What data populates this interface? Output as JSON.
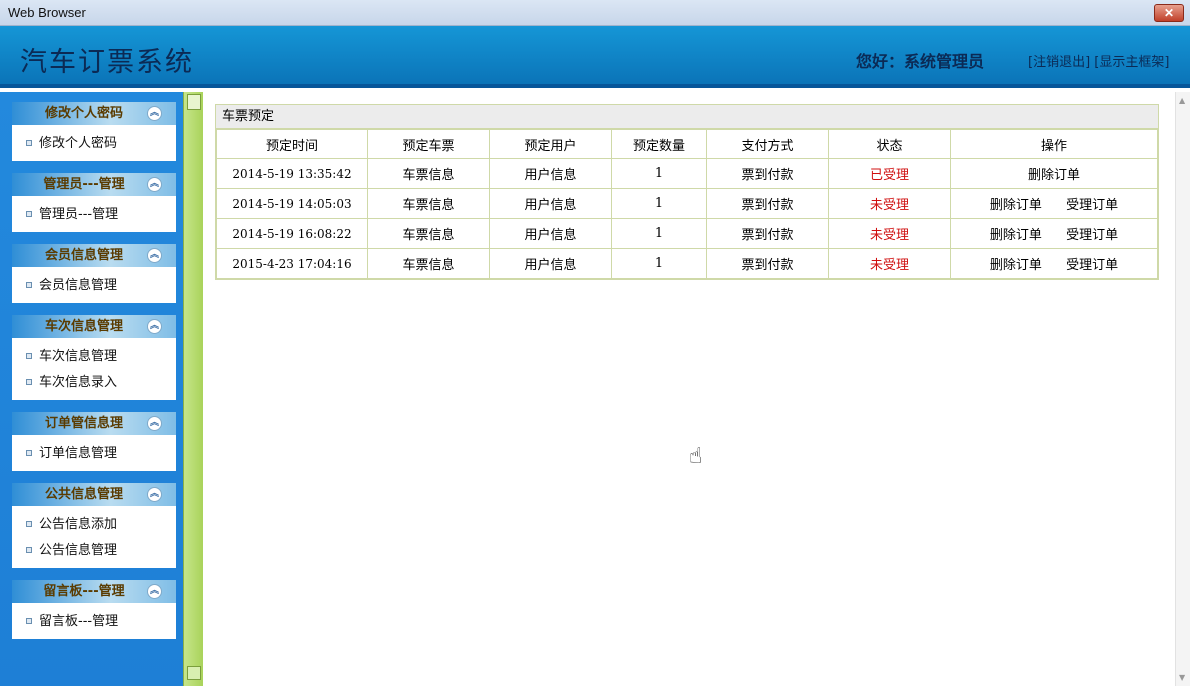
{
  "window": {
    "title": "Web Browser",
    "close_glyph": "✕"
  },
  "header": {
    "app_title": "汽车订票系统",
    "greeting": "您好：系统管理员",
    "logout_label": "[注销退出]",
    "toggle_label": "[显示主框架]"
  },
  "sidebar": {
    "groups": [
      {
        "title": "修改个人密码",
        "items": [
          "修改个人密码"
        ]
      },
      {
        "title": "管理员---管理",
        "items": [
          "管理员---管理"
        ]
      },
      {
        "title": "会员信息管理",
        "items": [
          "会员信息管理"
        ]
      },
      {
        "title": "车次信息管理",
        "items": [
          "车次信息管理",
          "车次信息录入"
        ]
      },
      {
        "title": "订单管信息理",
        "items": [
          "订单信息管理"
        ]
      },
      {
        "title": "公共信息管理",
        "items": [
          "公告信息添加",
          "公告信息管理"
        ]
      },
      {
        "title": "留言板---管理",
        "items": [
          "留言板---管理"
        ]
      }
    ]
  },
  "panel": {
    "title": "车票预定",
    "columns": [
      "预定时间",
      "预定车票",
      "预定用户",
      "预定数量",
      "支付方式",
      "状态",
      "操作"
    ],
    "rows": [
      {
        "time": "2014-5-19 13:35:42",
        "ticket": "车票信息",
        "user": "用户信息",
        "qty": "1",
        "pay": "票到付款",
        "status": "已受理",
        "actions": [
          "删除订单"
        ]
      },
      {
        "time": "2014-5-19 14:05:03",
        "ticket": "车票信息",
        "user": "用户信息",
        "qty": "1",
        "pay": "票到付款",
        "status": "未受理",
        "actions": [
          "删除订单",
          "受理订单"
        ]
      },
      {
        "time": "2014-5-19 16:08:22",
        "ticket": "车票信息",
        "user": "用户信息",
        "qty": "1",
        "pay": "票到付款",
        "status": "未受理",
        "actions": [
          "删除订单",
          "受理订单"
        ]
      },
      {
        "time": "2015-4-23 17:04:16",
        "ticket": "车票信息",
        "user": "用户信息",
        "qty": "1",
        "pay": "票到付款",
        "status": "未受理",
        "actions": [
          "删除订单",
          "受理订单"
        ]
      }
    ]
  },
  "colors": {
    "status": "#d01010",
    "header": "#0b74b8",
    "sidebar": "#1e7fd6",
    "splitter": "#b5dc6e"
  },
  "icons": {
    "collapse": "chevron-up-circle-icon",
    "bullet": "square-bullet-icon",
    "cursor": "hand-pointer-icon"
  }
}
